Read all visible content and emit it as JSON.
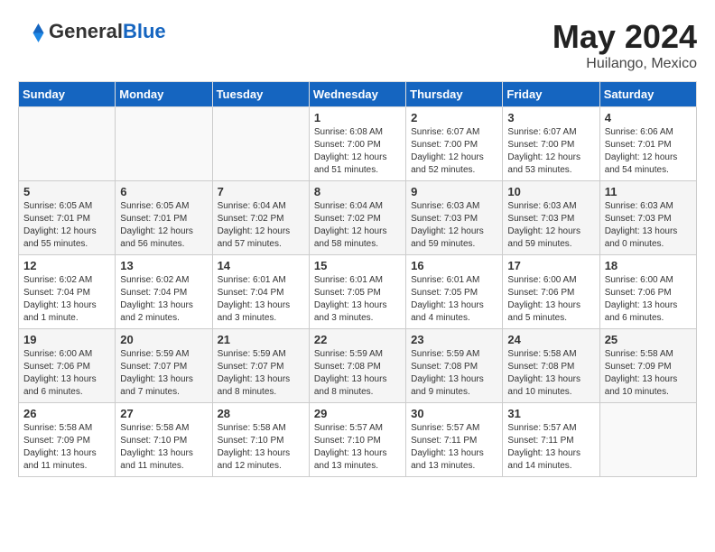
{
  "header": {
    "logo_general": "General",
    "logo_blue": "Blue",
    "title": "May 2024",
    "location": "Huilango, Mexico"
  },
  "weekdays": [
    "Sunday",
    "Monday",
    "Tuesday",
    "Wednesday",
    "Thursday",
    "Friday",
    "Saturday"
  ],
  "weeks": [
    [
      {
        "day": "",
        "detail": ""
      },
      {
        "day": "",
        "detail": ""
      },
      {
        "day": "",
        "detail": ""
      },
      {
        "day": "1",
        "detail": "Sunrise: 6:08 AM\nSunset: 7:00 PM\nDaylight: 12 hours\nand 51 minutes."
      },
      {
        "day": "2",
        "detail": "Sunrise: 6:07 AM\nSunset: 7:00 PM\nDaylight: 12 hours\nand 52 minutes."
      },
      {
        "day": "3",
        "detail": "Sunrise: 6:07 AM\nSunset: 7:00 PM\nDaylight: 12 hours\nand 53 minutes."
      },
      {
        "day": "4",
        "detail": "Sunrise: 6:06 AM\nSunset: 7:01 PM\nDaylight: 12 hours\nand 54 minutes."
      }
    ],
    [
      {
        "day": "5",
        "detail": "Sunrise: 6:05 AM\nSunset: 7:01 PM\nDaylight: 12 hours\nand 55 minutes."
      },
      {
        "day": "6",
        "detail": "Sunrise: 6:05 AM\nSunset: 7:01 PM\nDaylight: 12 hours\nand 56 minutes."
      },
      {
        "day": "7",
        "detail": "Sunrise: 6:04 AM\nSunset: 7:02 PM\nDaylight: 12 hours\nand 57 minutes."
      },
      {
        "day": "8",
        "detail": "Sunrise: 6:04 AM\nSunset: 7:02 PM\nDaylight: 12 hours\nand 58 minutes."
      },
      {
        "day": "9",
        "detail": "Sunrise: 6:03 AM\nSunset: 7:03 PM\nDaylight: 12 hours\nand 59 minutes."
      },
      {
        "day": "10",
        "detail": "Sunrise: 6:03 AM\nSunset: 7:03 PM\nDaylight: 12 hours\nand 59 minutes."
      },
      {
        "day": "11",
        "detail": "Sunrise: 6:03 AM\nSunset: 7:03 PM\nDaylight: 13 hours\nand 0 minutes."
      }
    ],
    [
      {
        "day": "12",
        "detail": "Sunrise: 6:02 AM\nSunset: 7:04 PM\nDaylight: 13 hours\nand 1 minute."
      },
      {
        "day": "13",
        "detail": "Sunrise: 6:02 AM\nSunset: 7:04 PM\nDaylight: 13 hours\nand 2 minutes."
      },
      {
        "day": "14",
        "detail": "Sunrise: 6:01 AM\nSunset: 7:04 PM\nDaylight: 13 hours\nand 3 minutes."
      },
      {
        "day": "15",
        "detail": "Sunrise: 6:01 AM\nSunset: 7:05 PM\nDaylight: 13 hours\nand 3 minutes."
      },
      {
        "day": "16",
        "detail": "Sunrise: 6:01 AM\nSunset: 7:05 PM\nDaylight: 13 hours\nand 4 minutes."
      },
      {
        "day": "17",
        "detail": "Sunrise: 6:00 AM\nSunset: 7:06 PM\nDaylight: 13 hours\nand 5 minutes."
      },
      {
        "day": "18",
        "detail": "Sunrise: 6:00 AM\nSunset: 7:06 PM\nDaylight: 13 hours\nand 6 minutes."
      }
    ],
    [
      {
        "day": "19",
        "detail": "Sunrise: 6:00 AM\nSunset: 7:06 PM\nDaylight: 13 hours\nand 6 minutes."
      },
      {
        "day": "20",
        "detail": "Sunrise: 5:59 AM\nSunset: 7:07 PM\nDaylight: 13 hours\nand 7 minutes."
      },
      {
        "day": "21",
        "detail": "Sunrise: 5:59 AM\nSunset: 7:07 PM\nDaylight: 13 hours\nand 8 minutes."
      },
      {
        "day": "22",
        "detail": "Sunrise: 5:59 AM\nSunset: 7:08 PM\nDaylight: 13 hours\nand 8 minutes."
      },
      {
        "day": "23",
        "detail": "Sunrise: 5:59 AM\nSunset: 7:08 PM\nDaylight: 13 hours\nand 9 minutes."
      },
      {
        "day": "24",
        "detail": "Sunrise: 5:58 AM\nSunset: 7:08 PM\nDaylight: 13 hours\nand 10 minutes."
      },
      {
        "day": "25",
        "detail": "Sunrise: 5:58 AM\nSunset: 7:09 PM\nDaylight: 13 hours\nand 10 minutes."
      }
    ],
    [
      {
        "day": "26",
        "detail": "Sunrise: 5:58 AM\nSunset: 7:09 PM\nDaylight: 13 hours\nand 11 minutes."
      },
      {
        "day": "27",
        "detail": "Sunrise: 5:58 AM\nSunset: 7:10 PM\nDaylight: 13 hours\nand 11 minutes."
      },
      {
        "day": "28",
        "detail": "Sunrise: 5:58 AM\nSunset: 7:10 PM\nDaylight: 13 hours\nand 12 minutes."
      },
      {
        "day": "29",
        "detail": "Sunrise: 5:57 AM\nSunset: 7:10 PM\nDaylight: 13 hours\nand 13 minutes."
      },
      {
        "day": "30",
        "detail": "Sunrise: 5:57 AM\nSunset: 7:11 PM\nDaylight: 13 hours\nand 13 minutes."
      },
      {
        "day": "31",
        "detail": "Sunrise: 5:57 AM\nSunset: 7:11 PM\nDaylight: 13 hours\nand 14 minutes."
      },
      {
        "day": "",
        "detail": ""
      }
    ]
  ]
}
